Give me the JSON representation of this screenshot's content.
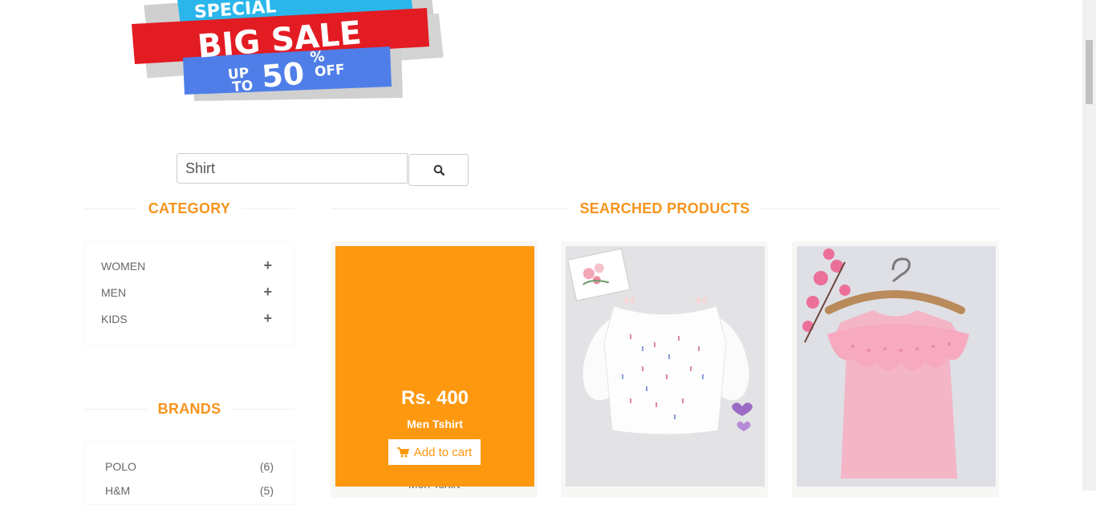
{
  "banner": {
    "line1": "SPECIAL",
    "line2": "BIG SALE",
    "line3_up": "UP",
    "line3_to": "TO",
    "line3_pct": "50",
    "line3_sym": "%",
    "line3_off": "OFF"
  },
  "search": {
    "value": "Shirt",
    "button_icon": "search-icon"
  },
  "sidebar": {
    "category_title": "CATEGORY",
    "categories": [
      {
        "label": "WOMEN",
        "icon": "plus-icon"
      },
      {
        "label": "MEN",
        "icon": "plus-icon"
      },
      {
        "label": "KIDS",
        "icon": "plus-icon"
      }
    ],
    "brands_title": "BRANDS",
    "brands": [
      {
        "label": "POLO",
        "count": "(6)"
      },
      {
        "label": "H&M",
        "count": "(5)"
      }
    ]
  },
  "main": {
    "title": "SEARCHED PRODUCTS",
    "products": [
      {
        "price": "Rs. 400",
        "name": "Men Tshirt",
        "add_to_cart": "Add to cart",
        "under_name": "Men Tshirt"
      },
      {
        "image": "white-off-shoulder-top"
      },
      {
        "image": "pink-ruffle-top"
      }
    ]
  },
  "colors": {
    "accent": "#fe980f",
    "title": "#f7941d",
    "sale_red": "#e31b23",
    "sale_blue": "#4f7ee8",
    "sale_cyan": "#2ab6ea"
  }
}
